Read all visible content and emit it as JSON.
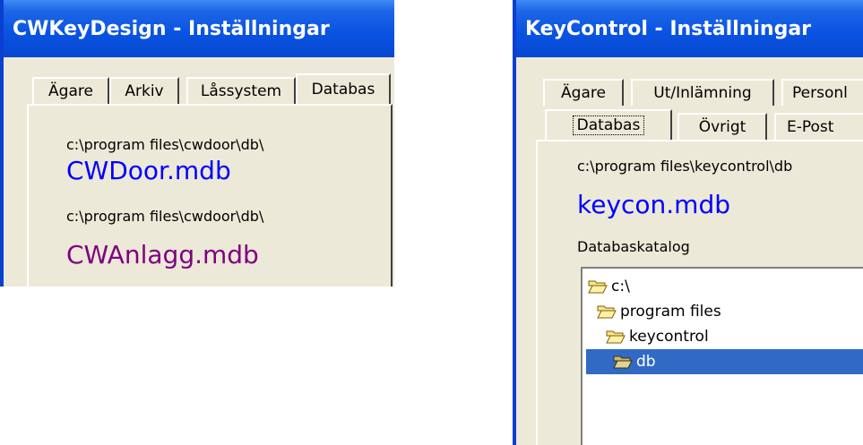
{
  "left_window": {
    "title": "CWKeyDesign - Inställningar",
    "tabs": [
      "Ägare",
      "Arkiv",
      "Låssystem",
      "Databas"
    ],
    "active_tab": "Databas",
    "entries": [
      {
        "path": "c:\\program files\\cwdoor\\db\\",
        "file": "CWDoor.mdb",
        "color": "#0000ff"
      },
      {
        "path": "c:\\program files\\cwdoor\\db\\",
        "file": "CWAnlagg.mdb",
        "color": "#800080"
      }
    ]
  },
  "right_window": {
    "title": "KeyControl - Inställningar",
    "tabs_row1": [
      "Ägare",
      "Ut/Inlämning",
      "Personl"
    ],
    "tabs_row2": [
      "Databas",
      "Övrigt",
      "E-Post"
    ],
    "active_tab": "Databas",
    "path": "c:\\program files\\keycontrol\\db",
    "file": "keycon.mdb",
    "file_color": "#0000ff",
    "catalog_label": "Databaskatalog",
    "tree": [
      "c:\\",
      "program files",
      "keycontrol",
      "db"
    ],
    "selected_node": "db",
    "icons": [
      "folder-open-icon",
      "folder-open-icon",
      "folder-open-icon",
      "folder-open-icon"
    ]
  }
}
